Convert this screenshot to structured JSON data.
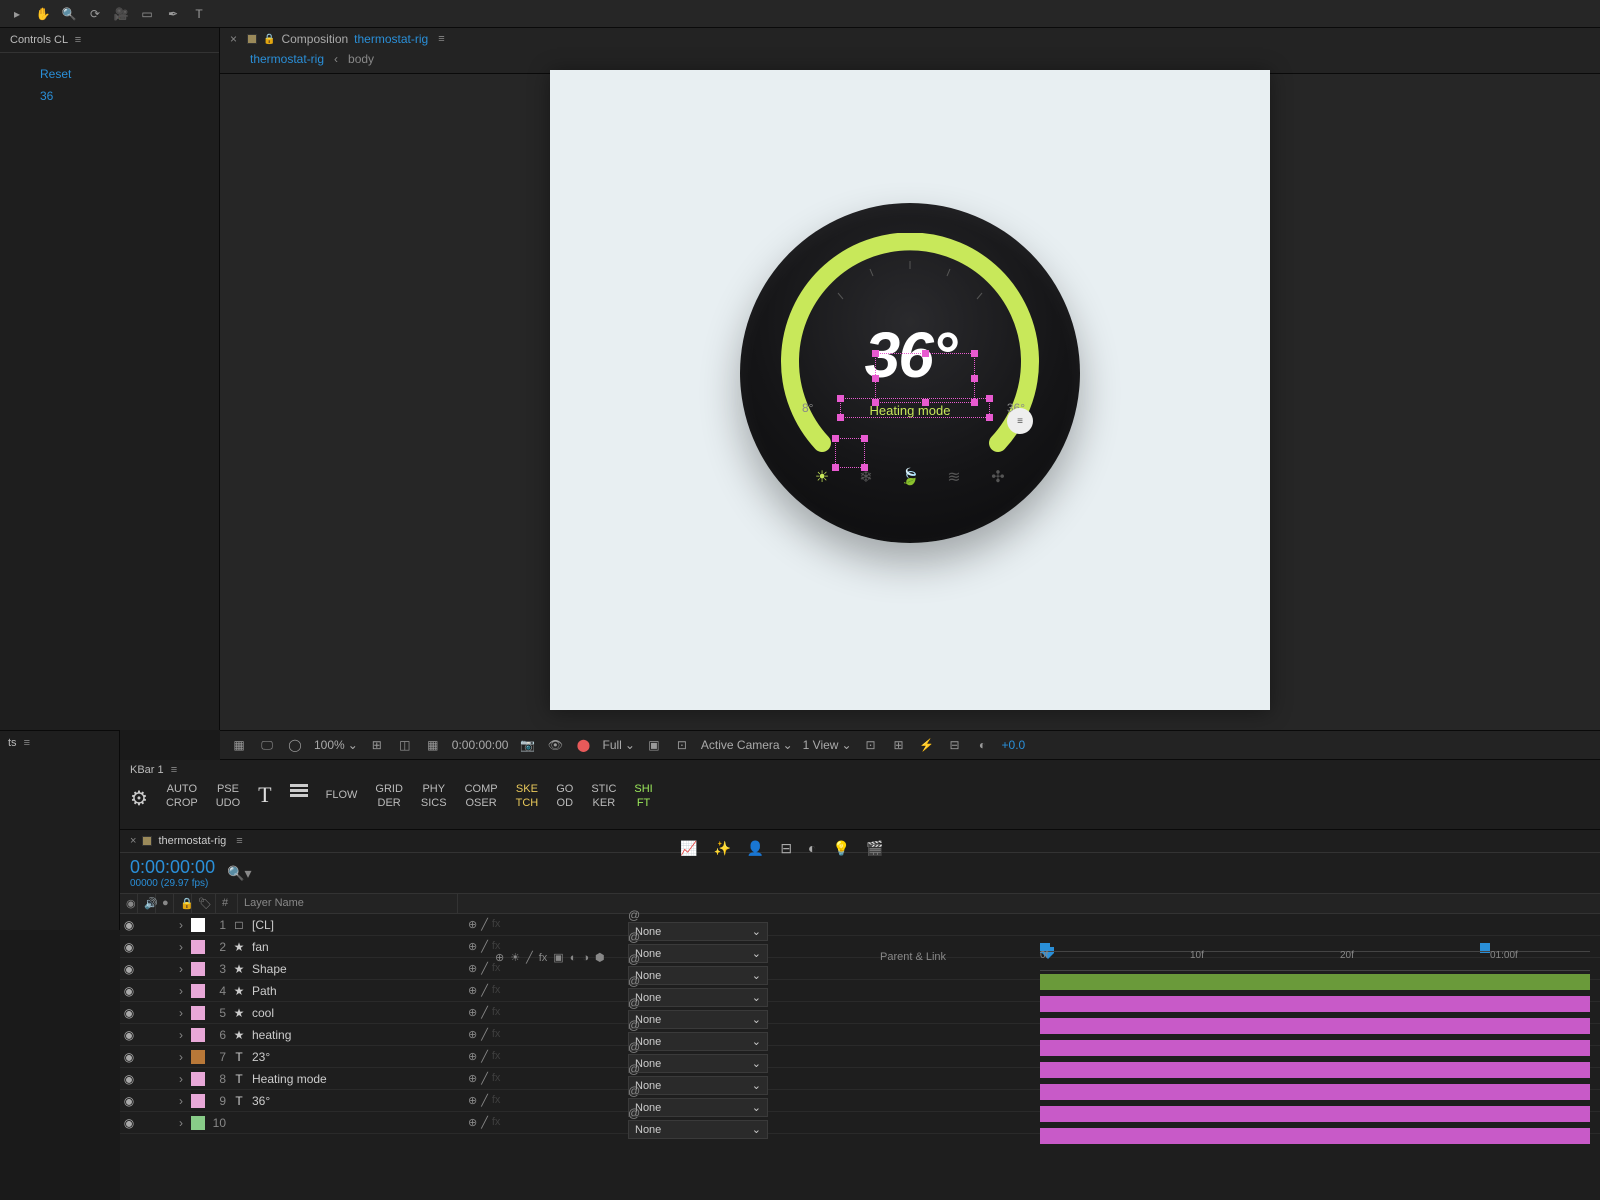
{
  "toolbar_icons": [
    "pointer",
    "hand",
    "zoom",
    "rotate",
    "camera",
    "shape",
    "pen",
    "text",
    "brush"
  ],
  "effect_controls": {
    "panel_title": "Controls CL",
    "reset_label": "Reset",
    "value": "36"
  },
  "left_bottom_panel": "ts",
  "comp_header": {
    "caption": "Composition",
    "comp_name": "thermostat-rig",
    "breadcrumb_active": "thermostat-rig",
    "breadcrumb_next": "body"
  },
  "thermostat": {
    "temperature": "36°",
    "mode_label": "Heating mode",
    "min_label": "8°",
    "max_label": "36°",
    "mode_icons": [
      "sun",
      "snowflake",
      "leaf",
      "wind",
      "fan"
    ]
  },
  "view_ctrl": {
    "zoom": "100%",
    "timecode": "0:00:00:00",
    "resolution": "Full",
    "camera": "Active Camera",
    "views": "1 View",
    "exposure": "+0.0"
  },
  "kbar": {
    "title": "KBar 1",
    "items": [
      {
        "t1": "AUTO",
        "t2": "CROP"
      },
      {
        "t1": "PSE",
        "t2": "UDO"
      },
      {
        "t1": "FLOW",
        "t2": ""
      },
      {
        "t1": "GRID",
        "t2": "DER"
      },
      {
        "t1": "PHY",
        "t2": "SICS"
      },
      {
        "t1": "COMP",
        "t2": "OSER"
      },
      {
        "t1": "SKE",
        "t2": "TCH",
        "cls": "yellow"
      },
      {
        "t1": "GO",
        "t2": "OD"
      },
      {
        "t1": "STIC",
        "t2": "KER"
      },
      {
        "t1": "SHI",
        "t2": "FT",
        "cls": "green"
      }
    ]
  },
  "timeline": {
    "comp_name": "thermostat-rig",
    "timecode": "0:00:00:00",
    "fps_label": "00000 (29.97 fps)",
    "col_layer_name": "Layer Name",
    "col_parent": "Parent & Link",
    "parent_none": "None",
    "layers": [
      {
        "n": 1,
        "color": "#ffffff",
        "icon": "□",
        "name": "[CL]"
      },
      {
        "n": 2,
        "color": "#e8a8d8",
        "icon": "★",
        "name": "fan"
      },
      {
        "n": 3,
        "color": "#e8a8d8",
        "icon": "★",
        "name": "Shape"
      },
      {
        "n": 4,
        "color": "#e8a8d8",
        "icon": "★",
        "name": "Path"
      },
      {
        "n": 5,
        "color": "#e8a8d8",
        "icon": "★",
        "name": "cool"
      },
      {
        "n": 6,
        "color": "#e8a8d8",
        "icon": "★",
        "name": "heating"
      },
      {
        "n": 7,
        "color": "#b87838",
        "icon": "T",
        "name": "23°"
      },
      {
        "n": 8,
        "color": "#e8a8d8",
        "icon": "T",
        "name": "Heating mode"
      },
      {
        "n": 9,
        "color": "#e8a8d8",
        "icon": "T",
        "name": "36°"
      },
      {
        "n": 10,
        "color": "#88cc88",
        "icon": "",
        "name": ""
      }
    ],
    "ruler_ticks": [
      "0f",
      "10f",
      "20f",
      "01:00f"
    ]
  }
}
